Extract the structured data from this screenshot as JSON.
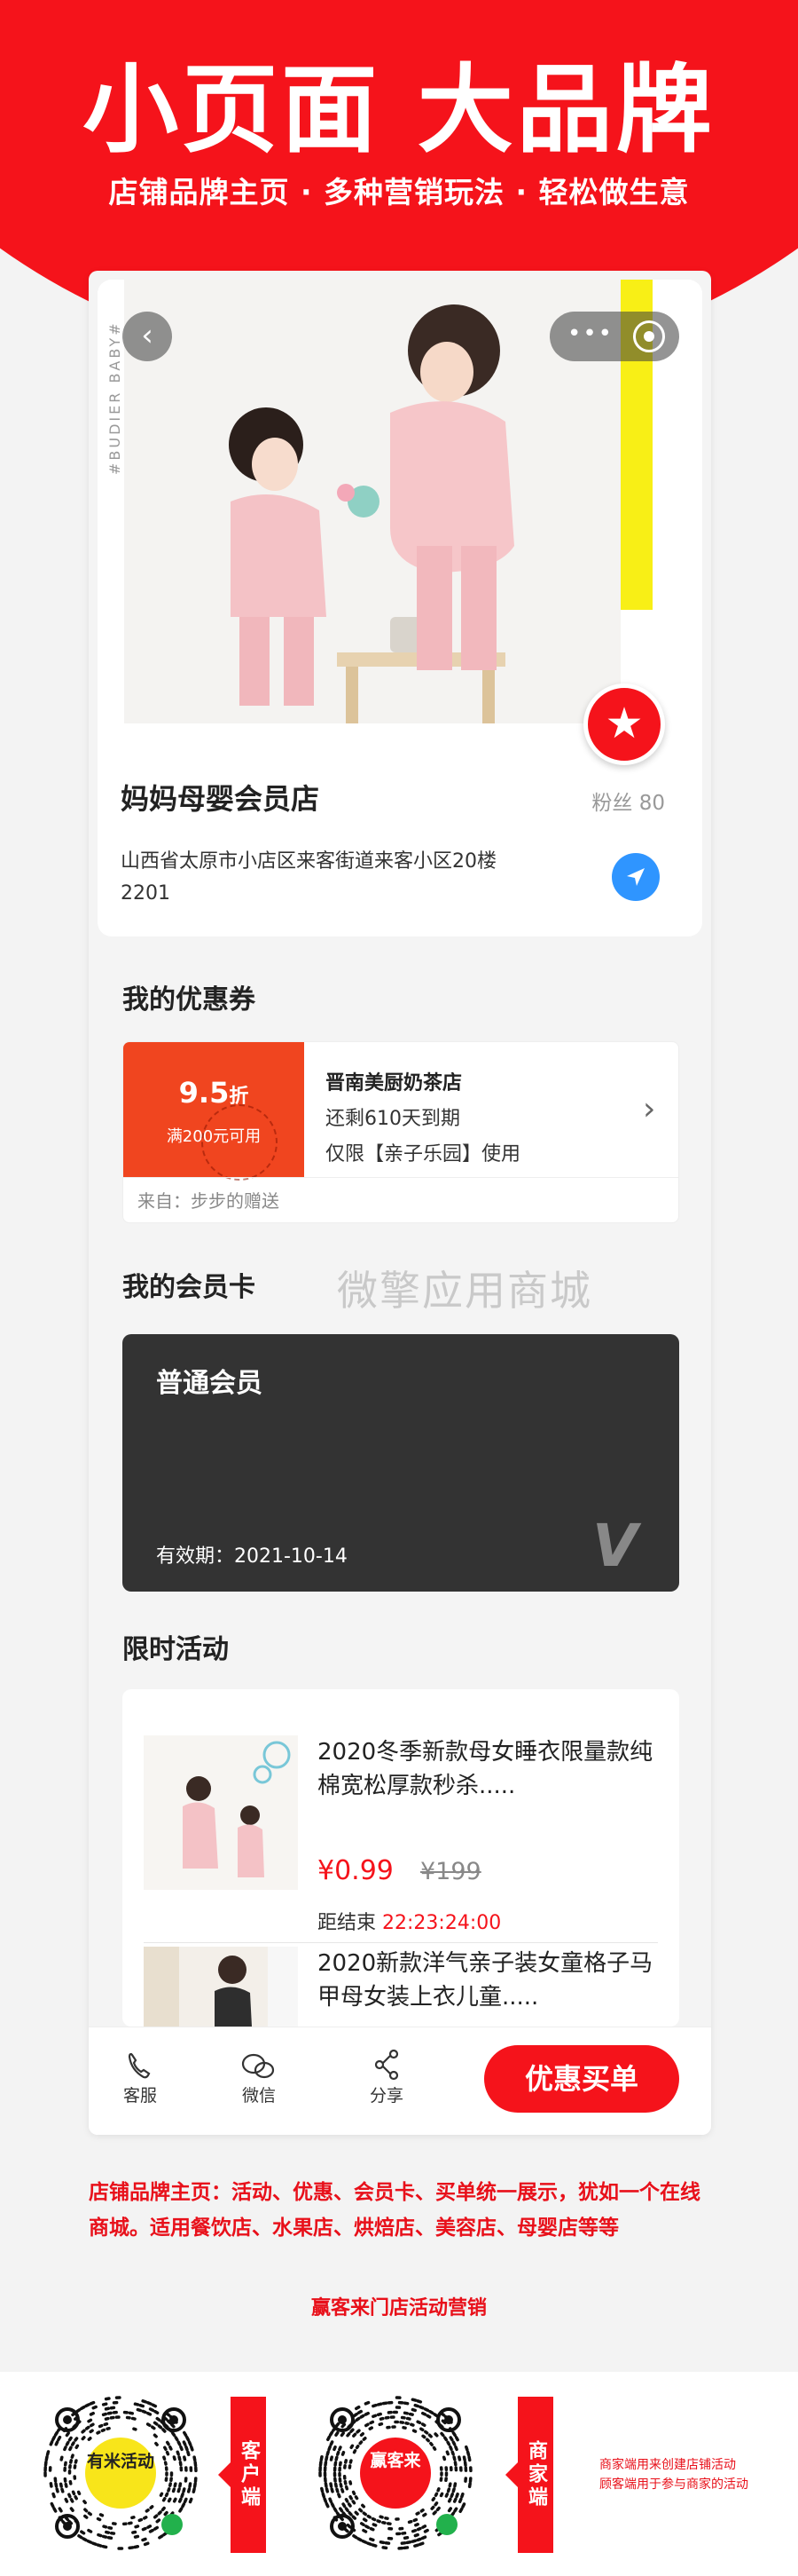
{
  "hero": {
    "title": "小页面 大品牌",
    "subtitle": "店铺品牌主页 · 多种营销玩法 · 轻松做生意"
  },
  "colors": {
    "brand_red": "#f5131b",
    "accent_yellow": "#f8ef16",
    "nav_blue": "#2f95ff",
    "coupon_orange": "#f0451f",
    "member_card": "#333333"
  },
  "store": {
    "vertical_tag": "#BUDIER BABY#",
    "name": "妈妈母婴会员店",
    "fans": "粉丝 80",
    "address": "山西省太原市小店区来客街道来客小区20楼2201",
    "icons": {
      "back": "chevron-left-icon",
      "more": "more-dots-icon",
      "close": "target-icon",
      "favorite": "star-icon",
      "navigate": "navigation-arrow-icon"
    }
  },
  "coupons": {
    "title": "我的优惠券",
    "item": {
      "discount": "9.5",
      "discount_unit": "折",
      "condition": "满200元可用",
      "shop": "晋南美厨奶茶店",
      "remaining": "还剩610天到期",
      "limit": "仅限【亲子乐园】使用",
      "from": "来自：步步的赠送"
    }
  },
  "watermark": "微擎应用商城",
  "member": {
    "title": "我的会员卡",
    "level": "普通会员",
    "valid": "有效期：2021-10-14",
    "logo": "V"
  },
  "activities": {
    "title": "限时活动",
    "items": [
      {
        "title": "2020冬季新款母女睡衣限量款纯棉宽松厚款秒杀.....",
        "price": "¥0.99",
        "old_price": "¥199",
        "countdown_label": "距结束",
        "countdown": "22:23:24:00"
      },
      {
        "title": "2020新款洋气亲子装女童格子马甲母女装上衣儿童....."
      }
    ]
  },
  "bottom_bar": {
    "service": "客服",
    "wechat": "微信",
    "share": "分享",
    "buy": "优惠买单"
  },
  "footer": {
    "description": "店铺品牌主页：活动、优惠、会员卡、买单统一展示，犹如一个在线商城。适用餐饮店、水果店、烘焙店、美容店、母婴店等等",
    "slogan": "赢客来门店活动营销",
    "qr_left_center": "有米活动",
    "qr_left_label": "客户端",
    "qr_right_center": "赢客来",
    "qr_right_label": "商家端",
    "note_line1": "商家端用来创建店铺活动",
    "note_line2": "顾客端用于参与商家的活动"
  }
}
